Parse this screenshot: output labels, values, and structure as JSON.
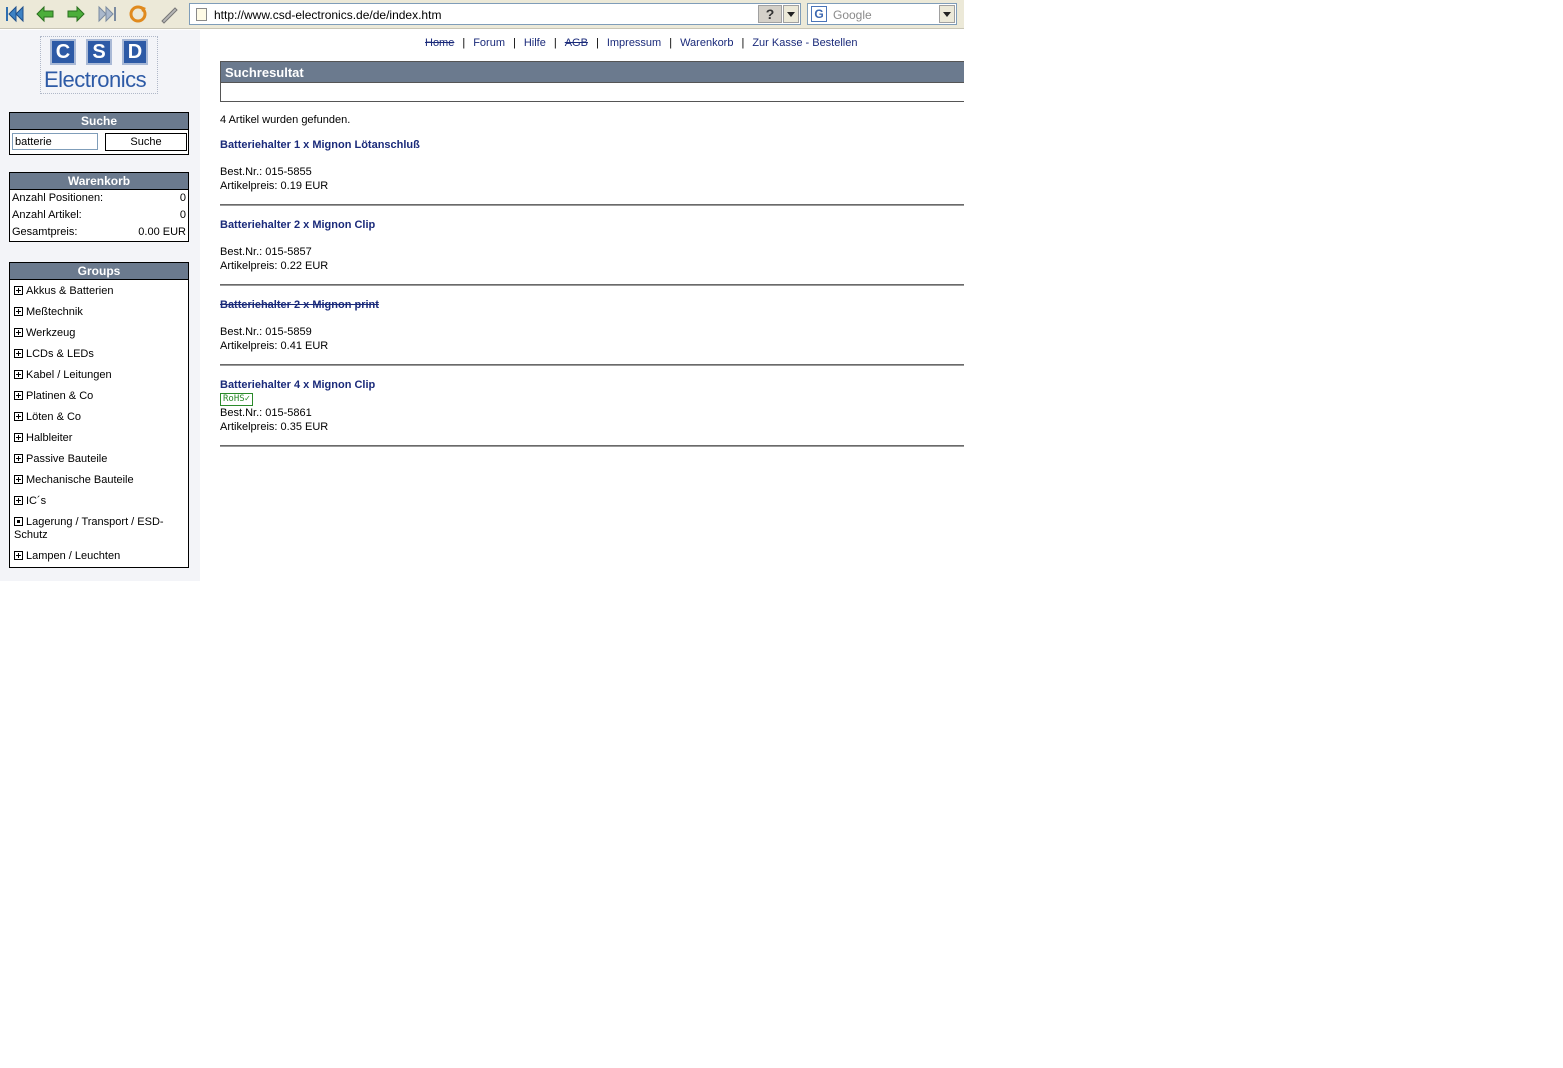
{
  "browser": {
    "url": "http://www.csd-electronics.de/de/index.htm",
    "help_symbol": "?",
    "search_placeholder": "Google",
    "search_engine_icon": "G",
    "icons": [
      "back-to-start-icon",
      "back-icon",
      "forward-icon",
      "forward-to-end-icon",
      "reload-icon",
      "edit-icon"
    ]
  },
  "logo": {
    "letters": [
      "C",
      "S",
      "D"
    ],
    "word": "Electronics"
  },
  "nav": {
    "home": "Home",
    "forum": "Forum",
    "hilfe": "Hilfe",
    "agb": "AGB",
    "impressum": "Impressum",
    "warenkorb": "Warenkorb",
    "kasse": "Zur Kasse - Bestellen",
    "separator": "|"
  },
  "search": {
    "title": "Suche",
    "value": "batterie",
    "button": "Suche"
  },
  "cart": {
    "title": "Warenkorb",
    "rows": [
      {
        "label": "Anzahl Positionen:",
        "value": "0"
      },
      {
        "label": "Anzahl Artikel:",
        "value": "0"
      },
      {
        "label": "Gesamtpreis:",
        "value": "0.00 EUR"
      }
    ]
  },
  "groups": {
    "title": "Groups",
    "items": [
      "Akkus & Batterien",
      "Meßtechnik",
      "Werkzeug",
      "LCDs & LEDs",
      "Kabel / Leitungen",
      "Platinen & Co",
      "Löten & Co",
      "Halbleiter",
      "Passive Bauteile",
      "Mechanische Bauteile",
      "IC´s",
      "Lagerung / Transport / ESD-Schutz",
      "Lampen / Leuchten"
    ]
  },
  "results": {
    "title": "Suchresultat",
    "found_text": "4 Artikel wurden gefunden.",
    "best_label": "Best.Nr.:",
    "price_label": "Artikelpreis:",
    "rohs_label": "RoHS✓",
    "articles": [
      {
        "title": "Batteriehalter 1 x Mignon Lötanschluß",
        "number": "015-5855",
        "price": "0.19 EUR"
      },
      {
        "title": "Batteriehalter 2 x Mignon Clip",
        "number": "015-5857",
        "price": "0.22 EUR"
      },
      {
        "title": "Batteriehalter 2 x Mignon print",
        "number": "015-5859",
        "price": "0.41 EUR"
      },
      {
        "title": "Batteriehalter 4 x Mignon Clip",
        "number": "015-5861",
        "price": "0.35 EUR"
      }
    ]
  }
}
